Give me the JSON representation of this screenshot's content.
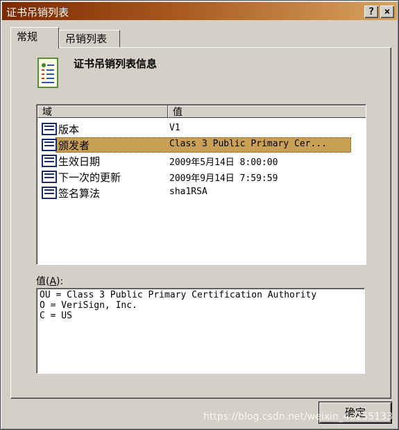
{
  "window": {
    "title": "证书吊销列表"
  },
  "titlebar_buttons": {
    "help": "?",
    "close": "×"
  },
  "tabs": [
    {
      "label": "常规",
      "active": true
    },
    {
      "label": "吊销列表",
      "active": false
    }
  ],
  "header": {
    "title": "证书吊销列表信息",
    "icon": "certificate-icon"
  },
  "list": {
    "columns": [
      "域",
      "值"
    ],
    "rows": [
      {
        "field": "版本",
        "value": "V1",
        "selected": false
      },
      {
        "field": "颁发者",
        "value": "Class 3 Public Primary Cer...",
        "selected": true
      },
      {
        "field": "生效日期",
        "value": "2009年5月14日 8:00:00",
        "selected": false
      },
      {
        "field": "下一次的更新",
        "value": "2009年9月14日 7:59:59",
        "selected": false
      },
      {
        "field": "签名算法",
        "value": "sha1RSA",
        "selected": false
      }
    ]
  },
  "value_section": {
    "label_prefix": "值(",
    "label_accel": "A",
    "label_suffix": "):",
    "content": "OU = Class 3 Public Primary Certification Authority\nO = VeriSign, Inc.\nC = US"
  },
  "ok_button": {
    "label": "确定"
  },
  "watermark": "https://blog.csdn.net/weixin_43255133",
  "colors": {
    "selection": "#c9a056",
    "title_start": "#7b2a00",
    "title_end": "#d9a35e"
  }
}
